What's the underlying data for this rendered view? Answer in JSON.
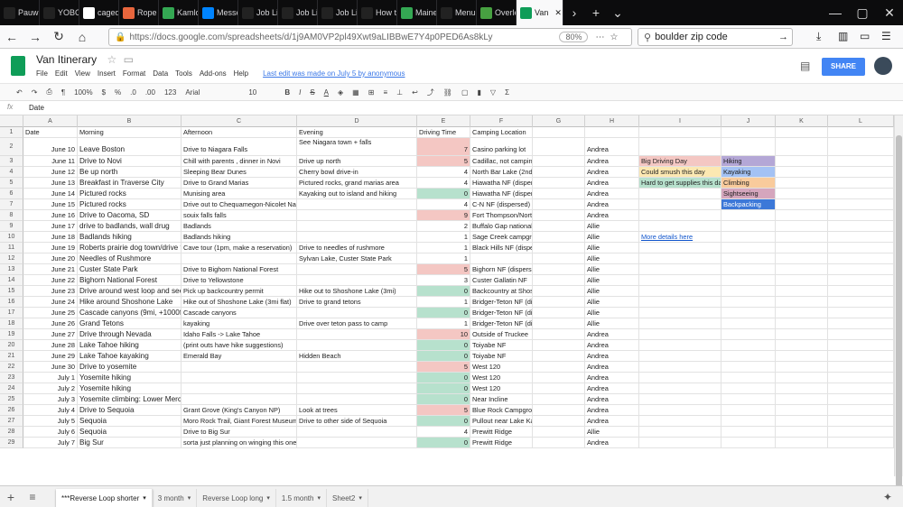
{
  "browser": {
    "tabs": [
      {
        "label": "Pauw",
        "icon": "amazon-icon",
        "color": "#222222"
      },
      {
        "label": "YOBO",
        "icon": "amazon-icon",
        "color": "#222222"
      },
      {
        "label": "caged",
        "icon": "google-icon",
        "color": "#ffffff"
      },
      {
        "label": "Rope",
        "icon": "bookmark-icon",
        "color": "#e8663d"
      },
      {
        "label": "Kamlo",
        "icon": "maps-icon",
        "color": "#34a853"
      },
      {
        "label": "Messe",
        "icon": "messenger-icon",
        "color": "#0084ff"
      },
      {
        "label": "Job Li",
        "icon": "indeed-icon",
        "color": "#222222"
      },
      {
        "label": "Job Li",
        "icon": "indeed-icon",
        "color": "#222222"
      },
      {
        "label": "Job Li",
        "icon": "indeed-icon",
        "color": "#222222"
      },
      {
        "label": "How t",
        "icon": "wikihow-icon",
        "color": "#222222"
      },
      {
        "label": "Maine",
        "icon": "maps-icon",
        "color": "#34a853"
      },
      {
        "label": "Menu",
        "icon": "page-icon",
        "color": "#222222"
      },
      {
        "label": "Overle",
        "icon": "overleaf-icon",
        "color": "#47a141"
      },
      {
        "label": "Van",
        "icon": "sheets-icon",
        "color": "#0f9d58"
      }
    ],
    "url": "https://docs.google.com/spreadsheets/d/1j9AM0VP2pl49Xwt9aLIBBwE7Y4p0PED6As8kLy",
    "zoom": "80%",
    "search": "boulder zip code"
  },
  "doc": {
    "title": "Van Itinerary",
    "menus": [
      "File",
      "Edit",
      "View",
      "Insert",
      "Format",
      "Data",
      "Tools",
      "Add-ons",
      "Help"
    ],
    "last_edit": "Last edit was made on July 5 by anonymous",
    "share_label": "SHARE"
  },
  "toolbar": {
    "zoom": "100%",
    "currency": "$",
    "percent": "%",
    "dec_less": ".0",
    "dec_more": ".00",
    "num_format": "123",
    "font": "Arial",
    "size": "10",
    "bold": "B",
    "italic": "I",
    "strike": "S",
    "text_color": "A"
  },
  "fx": {
    "label": "fx",
    "value": "Date"
  },
  "columns": [
    "A",
    "B",
    "C",
    "D",
    "E",
    "F",
    "G",
    "H",
    "I",
    "J",
    "K",
    "L"
  ],
  "rows": [
    {
      "n": "1",
      "a": "Date",
      "b": "Morning",
      "c": "Afternoon",
      "d": "Evening",
      "e": "Driving Time",
      "f": "Camping Location",
      "g": "",
      "h": "",
      "i": "",
      "j": ""
    },
    {
      "n": "2",
      "a": "June 10",
      "b": "Leave Boston",
      "c": "Drive to Niagara Falls",
      "d": "See Niagara town + falls",
      "e": "7",
      "f": "Casino parking lot",
      "g": "",
      "h": "Andrea",
      "i": "",
      "j": ""
    },
    {
      "n": "3",
      "a": "June 11",
      "b": "Drive to Novi",
      "c": "Chill with parents , dinner in Novi",
      "d": "Drive up north",
      "e": "5",
      "f": "Cadillac, not camping",
      "g": "",
      "h": "Andrea",
      "i": "Big Driving Day",
      "j": "Hiking"
    },
    {
      "n": "4",
      "a": "June 12",
      "b": "Be up north",
      "c": "Sleeping Bear Dunes",
      "d": "Cherry bowl drive-in",
      "e": "4",
      "f": "North Bar Lake (2nd lake north of empire",
      "g": "",
      "h": "Andrea",
      "i": "Could smush this day",
      "j": "Kayaking"
    },
    {
      "n": "5",
      "a": "June 13",
      "b": "Breakfast in Traverse City",
      "c": "Drive to Grand Marias",
      "d": "Pictured rocks, grand marias area",
      "e": "4",
      "f": "Hiawatha NF (dispersed, pull off on any road",
      "g": "",
      "h": "Andrea",
      "i": "Hard to get supplies this day",
      "j": "Climbing"
    },
    {
      "n": "6",
      "a": "June 14",
      "b": "Pictured rocks",
      "c": "Munising area",
      "d": "Kayaking out to island and hiking",
      "e": "0",
      "f": "Hiawatha NF (dispersed, pull off on any road",
      "g": "",
      "h": "Andrea",
      "i": "",
      "j": "Sightseeing"
    },
    {
      "n": "7",
      "a": "June 15",
      "b": "Pictured rocks",
      "c": "Drive out to Chequamegon-Nicolet National Forest",
      "d": "",
      "e": "4",
      "f": "C-N NF (dispersed)",
      "g": "",
      "h": "Andrea",
      "i": "",
      "j": "Backpacking"
    },
    {
      "n": "8",
      "a": "June 16",
      "b": "Drive to Oacoma, SD",
      "c": "souix falls falls",
      "d": "",
      "e": "9",
      "f": "Fort Thompson/North Shore Recreation Area",
      "g": "",
      "h": "Andrea",
      "i": "",
      "j": ""
    },
    {
      "n": "9",
      "a": "June 17",
      "b": "drive to badlands, wall drug",
      "c": "Badlands",
      "d": "",
      "e": "2",
      "f": "Buffalo Gap national grassland (dispersed)",
      "g": "",
      "h": "Allie",
      "i": "",
      "j": ""
    },
    {
      "n": "10",
      "a": "June 18",
      "b": "Badlands hiking",
      "c": "Badlands hiking",
      "d": "",
      "e": "1",
      "f": "Sage Creek campground (free primitive)",
      "g": "",
      "h": "Allie",
      "i": "More details here",
      "j": ""
    },
    {
      "n": "11",
      "a": "June 19",
      "b": "Roberts prairie dog town/drive to wall",
      "c": "Cave tour (1pm, make a reservation)",
      "d": "Drive to needles of rushmore",
      "e": "1",
      "f": "Black Hills NF (dispersed)",
      "g": "",
      "h": "Allie",
      "i": "",
      "j": ""
    },
    {
      "n": "12",
      "a": "June 20",
      "b": "Needles of Rushmore",
      "c": "",
      "d": "Sylvan Lake, Custer State Park",
      "e": "1",
      "f": "",
      "g": "",
      "h": "Allie",
      "i": "",
      "j": ""
    },
    {
      "n": "13",
      "a": "June 21",
      "b": "Custer State Park",
      "c": "Drive to Bighorn National Forest",
      "d": "",
      "e": "5",
      "f": "Bighorn NF (dispersed)",
      "g": "",
      "h": "Allie",
      "i": "",
      "j": ""
    },
    {
      "n": "14",
      "a": "June 22",
      "b": "Bighorn National Forest",
      "c": "Drive to Yellowstone",
      "d": "",
      "e": "3",
      "f": "Custer Gallatin NF",
      "g": "",
      "h": "Allie",
      "i": "",
      "j": ""
    },
    {
      "n": "15",
      "a": "June 23",
      "b": "Drive around west loop and see geysers",
      "c": "Pick up backcountry permit",
      "d": "Hike out to Shoshone Lake (3mi)",
      "e": "0",
      "f": "Backcountry at Shoshone Lake",
      "g": "",
      "h": "Allie",
      "i": "",
      "j": ""
    },
    {
      "n": "16",
      "a": "June 24",
      "b": "Hike around Shoshone Lake",
      "c": "Hike out of Shoshone Lake (3mi flat)",
      "d": "Drive to grand tetons",
      "e": "1",
      "f": "Bridger-Teton NF (dispersed or hatchet",
      "g": "",
      "h": "Allie",
      "i": "",
      "j": ""
    },
    {
      "n": "17",
      "a": "June 25",
      "b": "Cascade canyons (9mi, +1000ft)",
      "c": "Cascade canyons",
      "d": "",
      "e": "0",
      "f": "Bridger-Teton NF (dispersed or hatchet",
      "g": "",
      "h": "Allie",
      "i": "",
      "j": ""
    },
    {
      "n": "18",
      "a": "June 26",
      "b": "Grand Tetons",
      "c": "kayaking",
      "d": "Drive over teton pass to camp",
      "e": "1",
      "f": "Bridger-Teton NF (dispersed or hatchet",
      "g": "",
      "h": "Allie",
      "i": "",
      "j": ""
    },
    {
      "n": "19",
      "a": "June 27",
      "b": "Drive through Nevada",
      "c": "Idaho Falls -> Lake Tahoe",
      "d": "",
      "e": "10",
      "f": "Outside of Truckee",
      "g": "",
      "h": "Andrea",
      "i": "",
      "j": ""
    },
    {
      "n": "20",
      "a": "June 28",
      "b": "Lake Tahoe hiking",
      "c": "(print outs have hike suggestions)",
      "d": "",
      "e": "0",
      "f": "Toiyabe NF",
      "g": "",
      "h": "Andrea",
      "i": "",
      "j": ""
    },
    {
      "n": "21",
      "a": "June 29",
      "b": "Lake Tahoe kayaking",
      "c": "Emerald Bay",
      "d": "Hidden Beach",
      "e": "0",
      "f": "Toiyabe NF",
      "g": "",
      "h": "Andrea",
      "i": "",
      "j": ""
    },
    {
      "n": "22",
      "a": "June 30",
      "b": "Drive to yosemite",
      "c": "",
      "d": "",
      "e": "5",
      "f": "West 120",
      "g": "",
      "h": "Andrea",
      "i": "",
      "j": ""
    },
    {
      "n": "23",
      "a": "July 1",
      "b": "Yosemite hiking",
      "c": "",
      "d": "",
      "e": "0",
      "f": "West 120",
      "g": "",
      "h": "Andrea",
      "i": "",
      "j": ""
    },
    {
      "n": "24",
      "a": "July 2",
      "b": "Yosemite hiking",
      "c": "",
      "d": "",
      "e": "0",
      "f": "West 120",
      "g": "",
      "h": "Andrea",
      "i": "",
      "j": ""
    },
    {
      "n": "25",
      "a": "July 3",
      "b": "Yosemite climbing: Lower Merced River Canyon (El Portal area)",
      "c": "",
      "d": "",
      "e": "0",
      "f": "Near Incline",
      "g": "",
      "h": "Andrea",
      "i": "",
      "j": ""
    },
    {
      "n": "26",
      "a": "July 4",
      "b": "Drive to Sequoia",
      "c": "Grant Grove (King's Canyon NP)",
      "d": "Look at trees",
      "e": "5",
      "f": "Blue Rock Campground (free) 36.722",
      "g": "",
      "h": "Andrea",
      "i": "",
      "j": ""
    },
    {
      "n": "27",
      "a": "July 5",
      "b": "Sequoia",
      "c": "Moro Rock Trail, Giant Forest Museum",
      "d": "Drive to other side of Sequoia",
      "e": "0",
      "f": "Pullout near Lake Kaweah, 36.409935",
      "g": "",
      "h": "Andrea",
      "i": "",
      "j": ""
    },
    {
      "n": "28",
      "a": "July 6",
      "b": "Sequoia",
      "c": "Drive to Big Sur",
      "d": "",
      "e": "4",
      "f": "Prewitt Ridge",
      "g": "",
      "h": "Allie",
      "i": "",
      "j": ""
    },
    {
      "n": "29",
      "a": "July 7",
      "b": "Big Sur",
      "c": "sorta just planning on winging this one",
      "d": "",
      "e": "0",
      "f": "Prewitt Ridge",
      "g": "",
      "h": "Andrea",
      "i": "",
      "j": ""
    }
  ],
  "legend_colors": {
    "Big Driving Day": "#f4c7c3",
    "Could smush this day": "#fce8b2",
    "Hard to get supplies this day": "#b7e1cd",
    "Hiking": "#b4a7d6",
    "Kayaking": "#a4c2f4",
    "Climbing": "#f9cb9c",
    "Sightseeing": "#d5a6bd",
    "Backpacking": "#3c78d8"
  },
  "driving_colors": {
    "high": "#f4c7c3",
    "zero": "#b7e1cd"
  },
  "sheet_tabs": [
    "***Reverse Loop shorter",
    "3 month",
    "Reverse Loop long",
    "1.5 month",
    "Sheet2"
  ],
  "active_sheet": 0
}
